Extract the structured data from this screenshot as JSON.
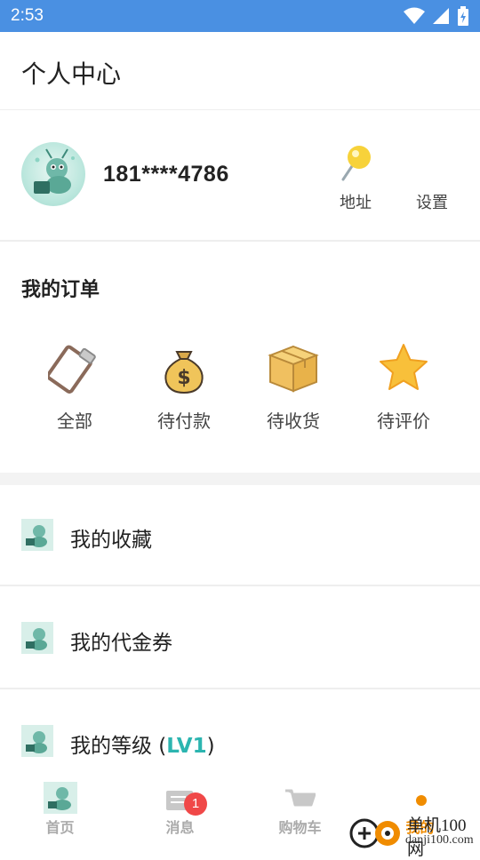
{
  "status_bar": {
    "time": "2:53",
    "icons": [
      "wifi-icon",
      "signal-icon",
      "battery-icon"
    ]
  },
  "header": {
    "title": "个人中心"
  },
  "profile": {
    "phone": "181****4786",
    "address_label": "地址",
    "settings_label": "设置"
  },
  "orders": {
    "title": "我的订单",
    "items": [
      {
        "label": "全部",
        "icon": "clipboard-icon"
      },
      {
        "label": "待付款",
        "icon": "money-bag-icon"
      },
      {
        "label": "待收货",
        "icon": "package-icon"
      },
      {
        "label": "待评价",
        "icon": "star-icon"
      }
    ]
  },
  "menu": {
    "items": [
      {
        "label": "我的收藏"
      },
      {
        "label": "我的代金券"
      },
      {
        "label_prefix": "我的等级 (",
        "level": "LV1",
        "label_suffix": ")"
      }
    ]
  },
  "tabbar": {
    "tabs": [
      {
        "label": "首页"
      },
      {
        "label": "消息",
        "badge": "1"
      },
      {
        "label": "购物车"
      },
      {
        "label": "我的"
      }
    ]
  },
  "watermark": {
    "text": "单机100网",
    "sub": "danji100.com"
  },
  "colors": {
    "status_bar": "#4a90e2",
    "accent": "#f08c00",
    "level": "#2cb5b0",
    "badge": "#f04848"
  }
}
